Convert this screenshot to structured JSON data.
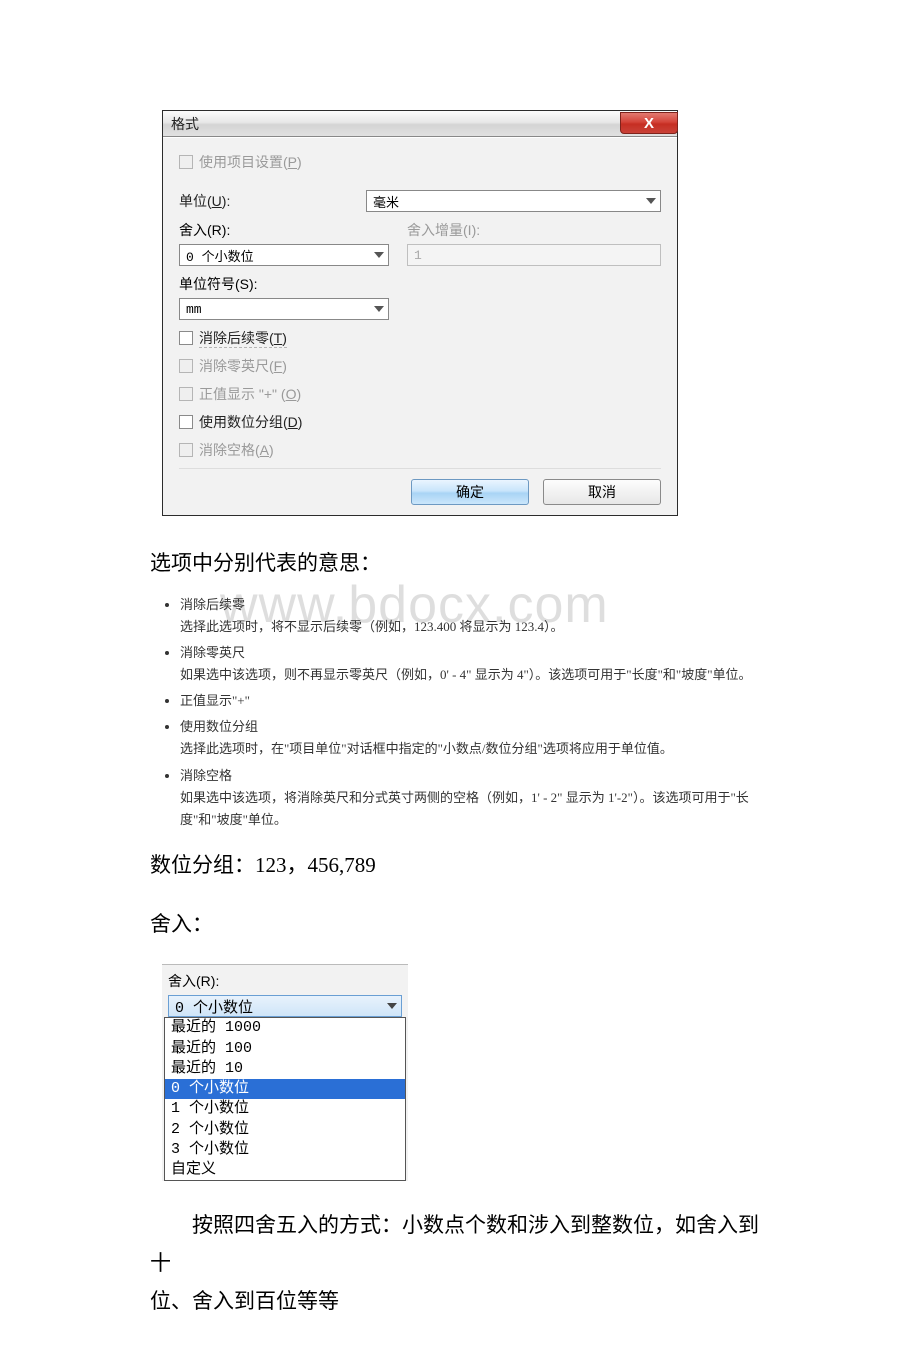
{
  "dialog": {
    "title": "格式",
    "close_glyph": "X",
    "use_project_settings": "使用项目设置(",
    "use_project_settings_u": "P",
    "use_project_settings_end": ")",
    "unit_label_pre": "单位(",
    "unit_label_u": "U",
    "unit_label_post": "):",
    "unit_value": "毫米",
    "round_label_pre": "舍入(",
    "round_label_u": "R",
    "round_label_post": "):",
    "round_value": "0 个小数位",
    "round_inc_label_pre": "舍入增量(",
    "round_inc_label_u": "I",
    "round_inc_label_post": "):",
    "round_inc_value": "1",
    "unit_sym_label_pre": "单位符号(",
    "unit_sym_label_u": "S",
    "unit_sym_label_post": "):",
    "unit_sym_value": "mm",
    "trailing_pre": "消除后续零(",
    "trailing_u": "T",
    "trailing_post": ")",
    "zero_feet_pre": "消除零英尺(",
    "zero_feet_u": "F",
    "zero_feet_post": ")",
    "show_plus_pre": "正值显示 \"+\" (",
    "show_plus_u": "O",
    "show_plus_post": ")",
    "digit_group_pre": "使用数位分组(",
    "digit_group_u": "D",
    "digit_group_post": ")",
    "spaces_pre": "消除空格(",
    "spaces_u": "A",
    "spaces_post": ")",
    "ok": "确定",
    "cancel": "取消"
  },
  "text": {
    "heading1": "选项中分别代表的意思："
  },
  "bullets": [
    {
      "title": "消除后续零",
      "desc": "选择此选项时，将不显示后续零（例如，123.400 将显示为 123.4）。"
    },
    {
      "title": "消除零英尺",
      "desc": "如果选中该选项，则不再显示零英尺（例如，0' - 4\" 显示为 4\"）。该选项可用于\"长度\"和\"坡度\"单位。"
    },
    {
      "title": "正值显示\"+\""
    },
    {
      "title": "使用数位分组",
      "desc": "选择此选项时，在\"项目单位\"对话框中指定的\"小数点/数位分组\"选项将应用于单位值。"
    },
    {
      "title": "消除空格",
      "desc": "如果选中该选项，将消除英尺和分式英寸两侧的空格（例如，1' - 2\" 显示为 1'-2\"）。该选项可用于\"长度\"和\"坡度\"单位。"
    }
  ],
  "grouping_line": "数位分组：123，456,789",
  "rounding_line": "舍入：",
  "round_snippet": {
    "label_pre": "舍入(",
    "label_u": "R",
    "label_post": "):",
    "current": "0 个小数位",
    "items": [
      "最近的 1000",
      "最近的 100",
      "最近的 10",
      "0  个小数位",
      "1  个小数位",
      "2  个小数位",
      "3  个小数位",
      "自定义"
    ],
    "selected_index": 3
  },
  "final_line1": "按照四舍五入的方式：小数点个数和涉入到整数位，如舍入到十",
  "final_line2": "位、舍入到百位等等",
  "watermark": "www.bdocx.com"
}
